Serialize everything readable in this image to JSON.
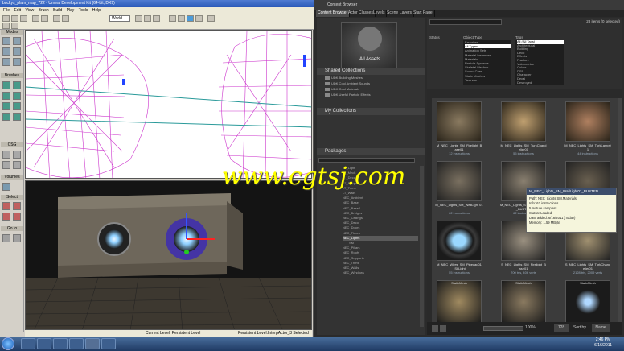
{
  "editor": {
    "title": "buckys_plam_map_722 - Unreal Development Kit (64-bit, DX9)",
    "menu": [
      "File",
      "Edit",
      "View",
      "Brush",
      "Build",
      "Play",
      "Tools",
      "Help"
    ],
    "toolbar_combo": "World",
    "sections": {
      "modes": "Modes",
      "brushes": "Brushes",
      "csg": "CSG",
      "volumes": "Volumes",
      "select": "Select",
      "goto": "Go to"
    },
    "status": {
      "level": "Current Level: Persistent Level",
      "right": "Persistent Level.InterpActor_3 Selected (480"
    }
  },
  "content_browser": {
    "title": "Content Browser",
    "tabs": [
      "Content Browser",
      "Actor Classes",
      "Levels",
      "Scene",
      "Layers",
      "Start Page"
    ],
    "all_assets": "All Assets",
    "shared_collections": "Shared Collections",
    "collections": [
      "UDK Building Meshes",
      "UDK Cool Ambient Sounds",
      "UDK Cool Materials",
      "UDK Useful Particle Effects"
    ],
    "my_collections": "My Collections",
    "packages": "Packages",
    "package_tree": [
      "LT_Light",
      "LT_Mech",
      "LT_Deco",
      "LT_Support",
      "LT_Trims",
      "LT_Walls",
      "NEC_Ambient",
      "NEC_Base",
      "NEC_Base2",
      "NEC_Bridges",
      "NEC_Ceilings",
      "NEC_Deco",
      "NEC_Doors",
      "NEC_Floors",
      "NEC_Lights",
      "SM",
      "NEC_Pillars",
      "NEC_Roofs",
      "NEC_Supports",
      "NEC_Trims",
      "NEC_Walls",
      "NEC_Windows"
    ],
    "items_count": "28 items (0 selected)",
    "filter_col1": "Status",
    "filter_col2": "Object Type",
    "filter_col3": "Tags",
    "object_types": [
      "Favorites",
      "All Types",
      "Animation Sets",
      "Material Instances",
      "Materials",
      "Particle Systems",
      "Skeletal Meshes",
      "Sound Cues",
      "Static Meshes",
      "Textures"
    ],
    "tags": [
      "All (All Tags)",
      "Architectural",
      "Building",
      "Deco",
      "Effects",
      "Fracture",
      "Volumetrics",
      "Colors",
      "DSP",
      "Character",
      "Decal",
      "Destroyed"
    ],
    "assets": [
      {
        "name": "M_NEC_Lights_SM_Firelight_B ase01",
        "sub": "12 instructions"
      },
      {
        "name": "M_NEC_Lights_SM_TurkChand elier01",
        "sub": "55 instructions"
      },
      {
        "name": "M_NEC_Lights_SM_TurkLamp0 1",
        "sub": "44 instructions"
      },
      {
        "name": "M_NEC_Lights_SM_WallLight 01",
        "sub": "62 instructions"
      },
      {
        "name": "M_NEC_Lights_SM_WallLight01 _BUSTED",
        "sub": "62 instructions"
      },
      {
        "name": "",
        "sub": ""
      },
      {
        "name": "M_NEC_Wires_SM_Pipecap01 _SkLight",
        "sub": "55 instructions"
      },
      {
        "name": "S_NEC_Lights_SM_Firelight_B ase01",
        "sub": "700 tris, 406 verts"
      },
      {
        "name": "S_NEC_Lights_SM_TurkChand elier01",
        "sub": "2128 tris, 2009 verts"
      },
      {
        "name": "StaticMesh",
        "sub": ""
      },
      {
        "name": "StaticMesh",
        "sub": ""
      },
      {
        "name": "StaticMesh",
        "sub": ""
      }
    ],
    "tooltip": {
      "title": "M_NEC_Lights_SM_WallLight01_BUSTED",
      "path": "Path:   NEC_Lights.SM.Materials",
      "info": "Info:   62 instructions",
      "samplers": "         5 texture samplers",
      "status": "Status:  Loaded",
      "added": "Date added:   6/16/2011 (Today)",
      "memory": "Memory:   1.59 MByte"
    },
    "zoom": "100%",
    "thumb_size": "128",
    "sort_label": "Sort by",
    "sort_value": "Name"
  },
  "taskbar": {
    "time": "2:46 PM",
    "date": "6/16/2011"
  },
  "watermark": "www.cgtsj.com"
}
